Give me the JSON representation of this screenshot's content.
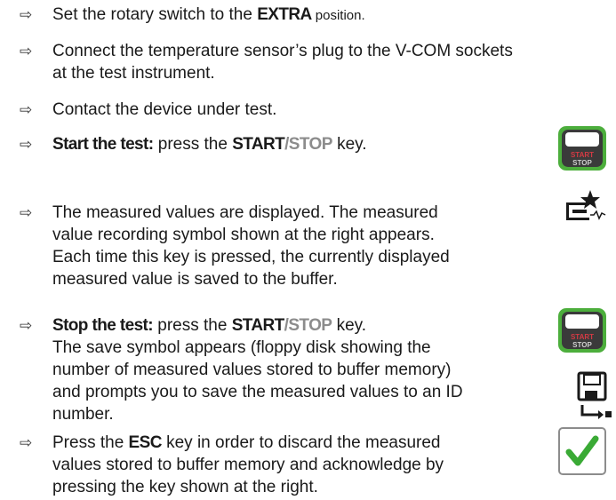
{
  "steps": [
    {
      "pre": "Set the rotary switch to the ",
      "key": "EXTRA",
      "post": " position."
    },
    {
      "lines": [
        "Connect the temperature sensor’s plug to the V-COM sockets",
        "at the test instrument."
      ]
    },
    {
      "lines": [
        "Contact the device under test."
      ]
    },
    {
      "bold_lead": "Start the test:",
      "pre": " press the ",
      "key1": "START",
      "slash": "/",
      "key2": "STOP",
      "post": " key."
    },
    {
      "lines": [
        "The measured values are displayed. The measured",
        "value recording symbol shown at the right appears.",
        "Each time this key is pressed, the currently displayed",
        "measured value is saved to the buffer."
      ]
    },
    {
      "bold_lead": "Stop the test:",
      "pre": " press the ",
      "key1": "START",
      "slash": "/",
      "key2": "STOP",
      "post": " key.",
      "lines": [
        "The save symbol appears (floppy disk showing the",
        "number of measured values stored to buffer memory)",
        "and prompts you to save the measured values to an ID",
        "number."
      ]
    },
    {
      "pre": "Press the ",
      "key": "ESC",
      "post": " key in order to discard the measured",
      "lines": [
        "values stored to buffer memory and acknowledge by",
        "pressing the key shown at the right."
      ]
    }
  ],
  "bullet": "⇨",
  "start_stop_icon": {
    "line1": "START",
    "line2": "STOP"
  },
  "colors": {
    "green": "#4cae3c",
    "dark": "#3a3a3a",
    "check": "#3aaa35",
    "start_text": "#b0202a"
  }
}
